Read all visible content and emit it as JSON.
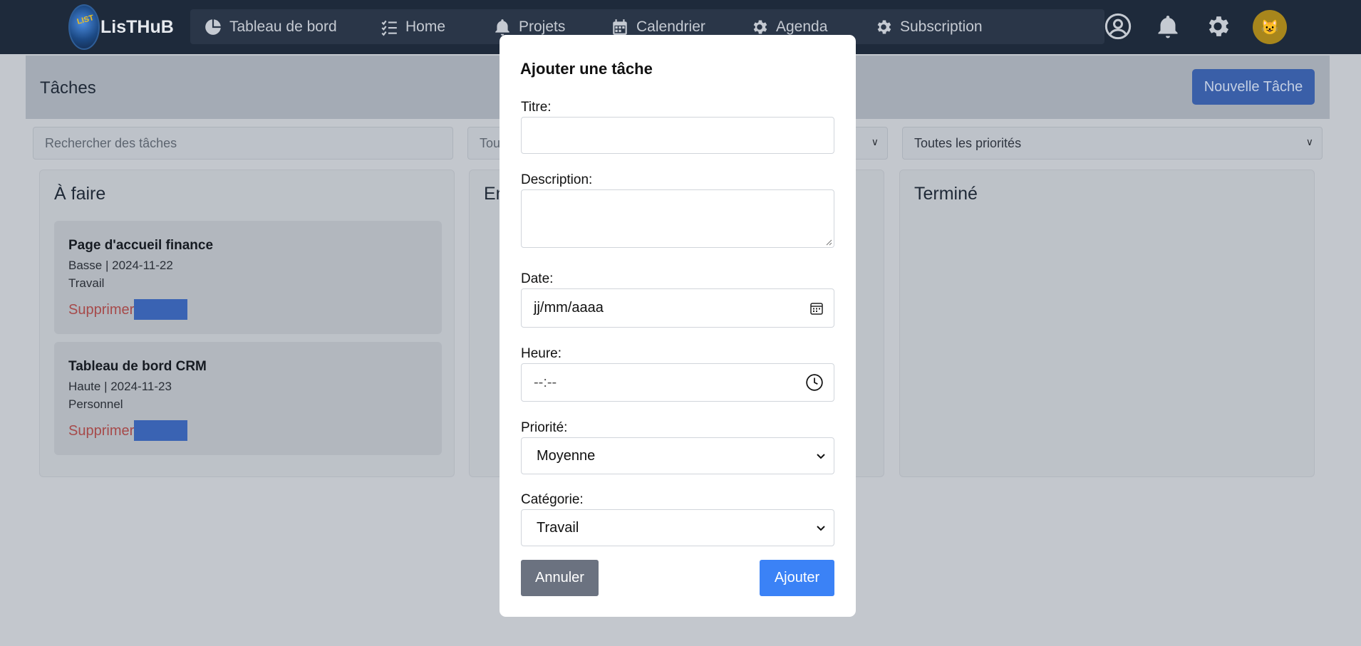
{
  "navbar": {
    "brand": "LisTHuB",
    "logo_text": "LIST",
    "items": [
      {
        "label": "Tableau de bord",
        "icon": "pie-chart-icon"
      },
      {
        "label": "Home",
        "icon": "checklist-icon"
      },
      {
        "label": "Projets",
        "icon": "bell-icon"
      },
      {
        "label": "Calendrier",
        "icon": "calendar-icon"
      },
      {
        "label": "Agenda",
        "icon": "gear-icon"
      },
      {
        "label": "Subscription",
        "icon": "gear-icon"
      }
    ],
    "right_icons": [
      "user-circle-icon",
      "bell-icon",
      "gear-icon"
    ],
    "avatar_glyph": "😺"
  },
  "page": {
    "title": "Tâches",
    "new_task_button": "Nouvelle Tâche",
    "search_placeholder": "Rechercher des tâches",
    "status_filter": "Tou",
    "priority_filter": "Toutes les priorités"
  },
  "columns": [
    {
      "title": "À faire"
    },
    {
      "title": "En"
    },
    {
      "title": "Terminé"
    }
  ],
  "tasks": [
    {
      "title": "Page d'accueil finance",
      "meta": "Basse | 2024-11-22",
      "category": "Travail",
      "delete_label": "Supprimer"
    },
    {
      "title": "Tableau de bord CRM",
      "meta": "Haute | 2024-11-23",
      "category": "Personnel",
      "delete_label": "Supprimer"
    }
  ],
  "modal": {
    "title": "Ajouter une tâche",
    "fields": {
      "title_label": "Titre:",
      "title_value": "",
      "description_label": "Description:",
      "description_value": "",
      "date_label": "Date:",
      "date_placeholder": "jj/mm/aaaa",
      "time_label": "Heure:",
      "time_placeholder": "--:--",
      "priority_label": "Priorité:",
      "priority_value": "Moyenne",
      "category_label": "Catégorie:",
      "category_value": "Travail"
    },
    "cancel_label": "Annuler",
    "add_label": "Ajouter"
  },
  "colors": {
    "navbar_bg": "#1e2a3b",
    "primary": "#3b82f6",
    "cancel": "#6b7280",
    "delete_text": "#a64a4a",
    "avatar_bg": "#a8861c"
  }
}
